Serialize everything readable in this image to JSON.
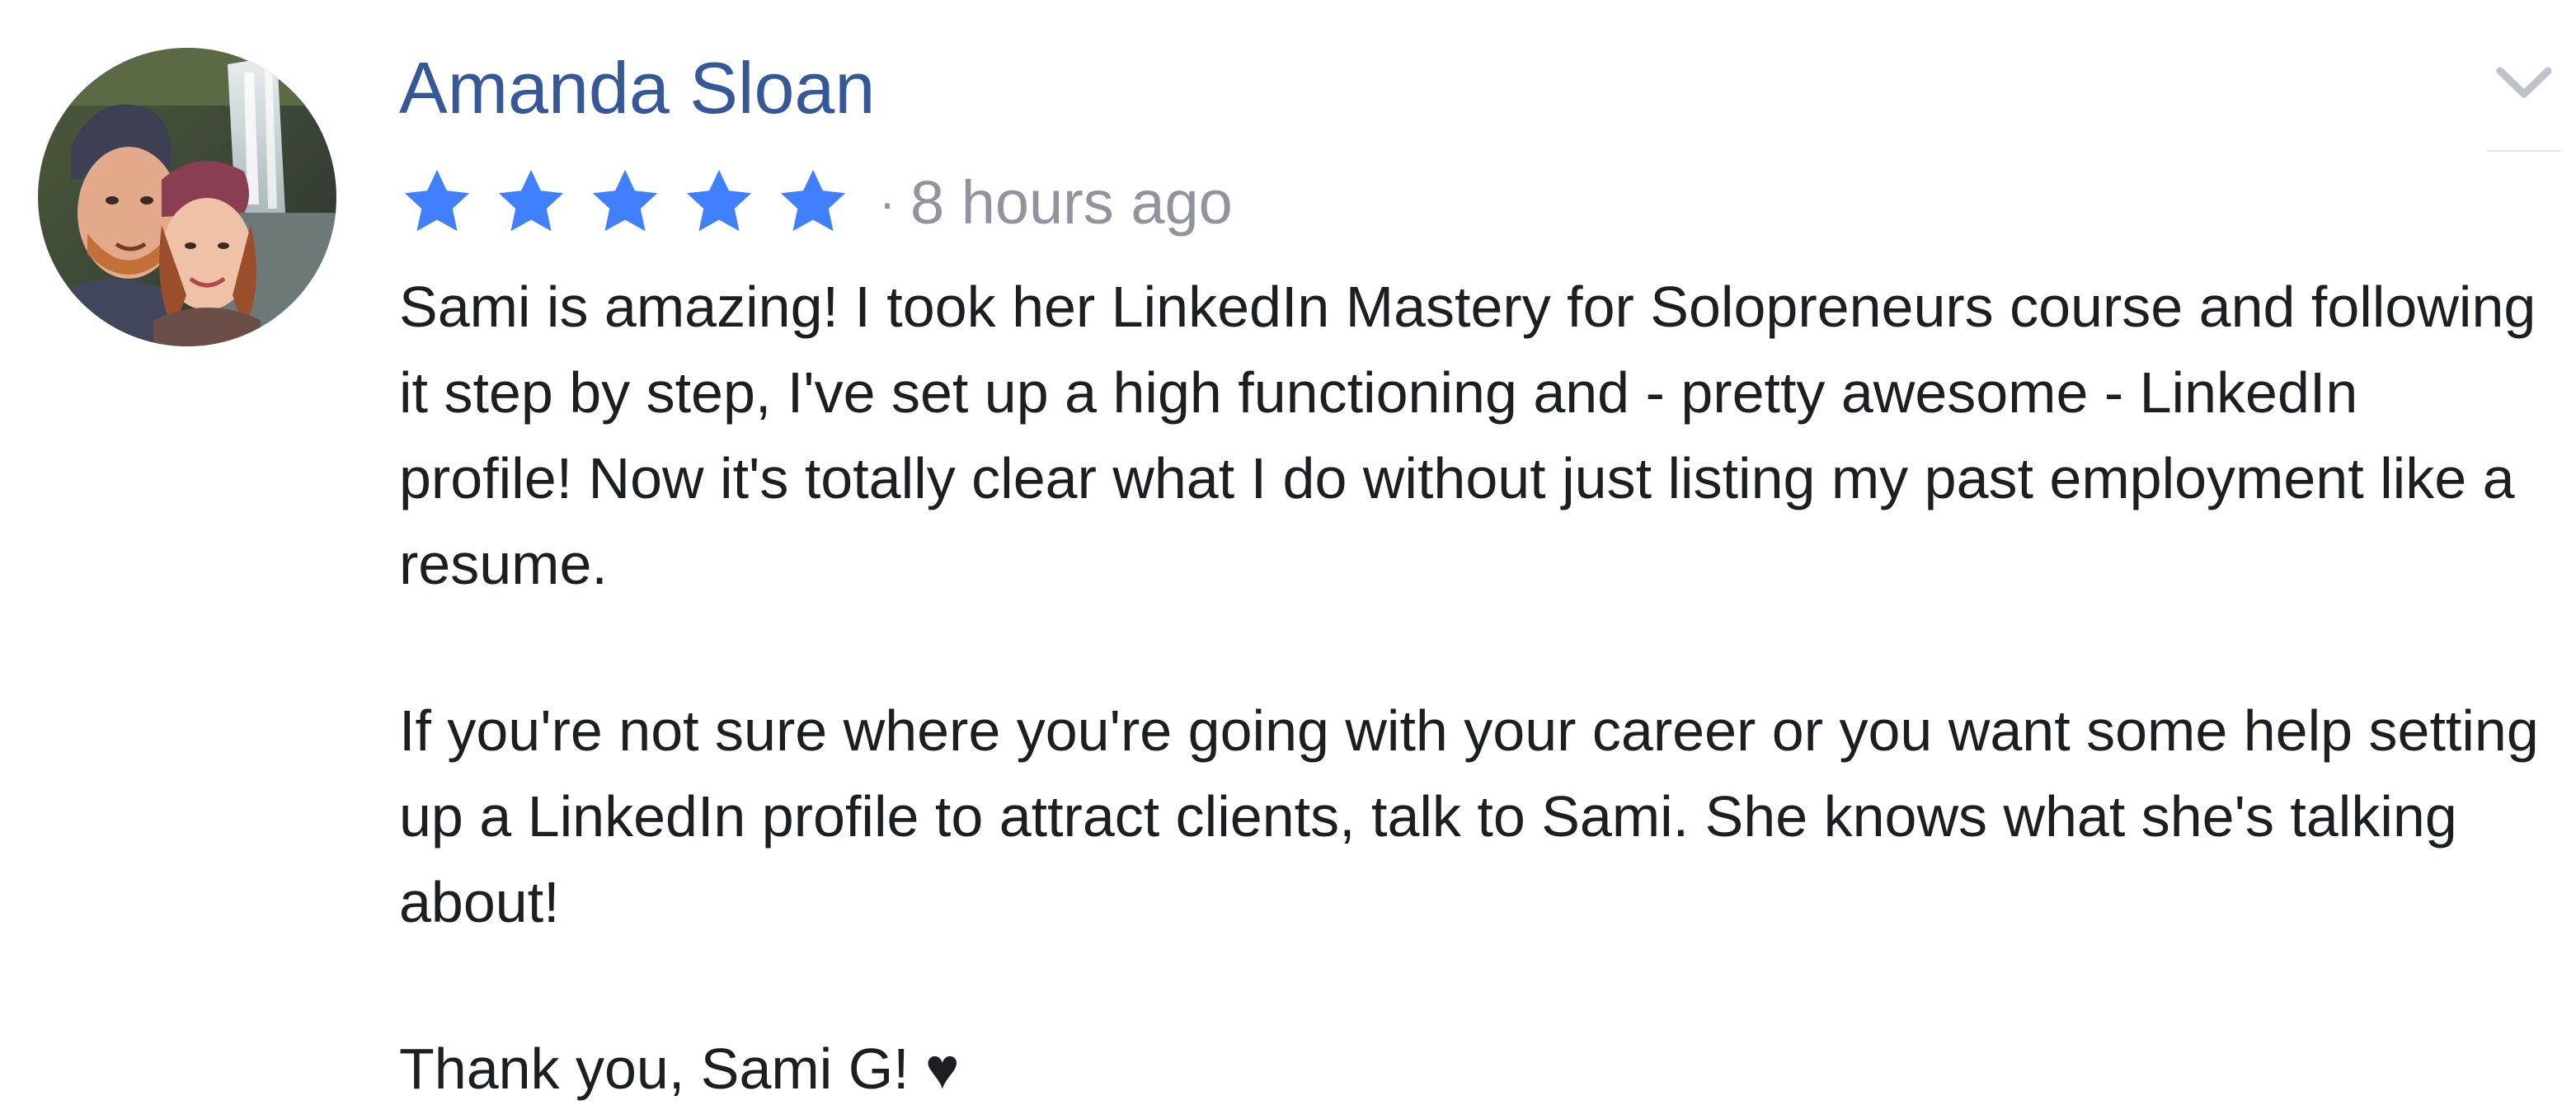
{
  "review": {
    "author_name": "Amanda Sloan",
    "rating": 5,
    "rating_max": 5,
    "separator": "·",
    "timestamp": "8 hours ago",
    "paragraphs": [
      "Sami is amazing! I took her LinkedIn Mastery for Solopreneurs course and following it step by step, I've set up a high functioning and - pretty awesome - LinkedIn profile! Now it's totally clear what I do without just listing my past employment like a resume.",
      "If you're not sure where you're going with your career or you want some help setting up a LinkedIn profile to attract clients, talk to Sami. She knows what she's talking about!",
      "Thank you, Sami G! ♥"
    ]
  },
  "icons": {
    "star": "star-icon",
    "menu": "chevron-down-icon"
  },
  "colors": {
    "author_name": "#365899",
    "star": "#4080ff",
    "timestamp": "#90949c",
    "body_text": "#1c1e21",
    "chevron": "#bec3c9"
  }
}
